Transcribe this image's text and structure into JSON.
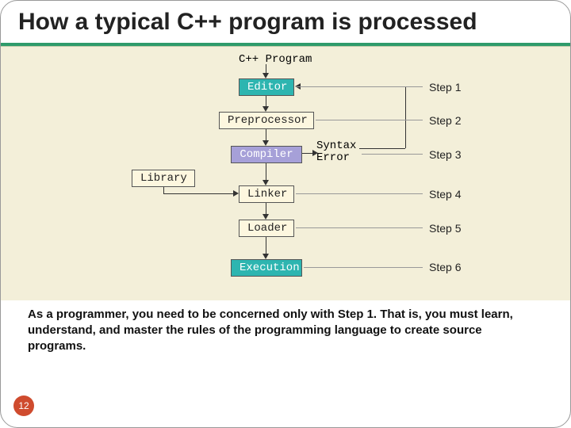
{
  "title": "How a typical C++ program is processed",
  "page_number": "12",
  "footer": "As a programmer, you need to be concerned only with Step 1. That is, you must learn, understand, and master the rules of the programming language to create source programs.",
  "diagram": {
    "top_label": "C++ Program",
    "nodes": {
      "editor": "Editor",
      "preprocessor": "Preprocessor",
      "compiler": "Compiler",
      "linker": "Linker",
      "loader": "Loader",
      "execution": "Execution",
      "library": "Library",
      "syntax_error_l1": "Syntax",
      "syntax_error_l2": "Error"
    },
    "steps": {
      "s1": "Step 1",
      "s2": "Step 2",
      "s3": "Step 3",
      "s4": "Step 4",
      "s5": "Step 5",
      "s6": "Step 6"
    }
  },
  "chart_data": {
    "type": "diagram",
    "title": "C++ program processing pipeline",
    "nodes": [
      {
        "id": "src",
        "label": "C++ Program"
      },
      {
        "id": "editor",
        "label": "Editor",
        "step": 1
      },
      {
        "id": "preprocessor",
        "label": "Preprocessor",
        "step": 2
      },
      {
        "id": "compiler",
        "label": "Compiler",
        "step": 3
      },
      {
        "id": "syntax_error",
        "label": "Syntax Error"
      },
      {
        "id": "library",
        "label": "Library"
      },
      {
        "id": "linker",
        "label": "Linker",
        "step": 4
      },
      {
        "id": "loader",
        "label": "Loader",
        "step": 5
      },
      {
        "id": "execution",
        "label": "Execution",
        "step": 6
      }
    ],
    "edges": [
      {
        "from": "src",
        "to": "editor"
      },
      {
        "from": "editor",
        "to": "preprocessor"
      },
      {
        "from": "preprocessor",
        "to": "compiler"
      },
      {
        "from": "compiler",
        "to": "linker"
      },
      {
        "from": "compiler",
        "to": "syntax_error"
      },
      {
        "from": "syntax_error",
        "to": "editor",
        "note": "loop back"
      },
      {
        "from": "library",
        "to": "linker"
      },
      {
        "from": "linker",
        "to": "loader"
      },
      {
        "from": "loader",
        "to": "execution"
      }
    ]
  }
}
